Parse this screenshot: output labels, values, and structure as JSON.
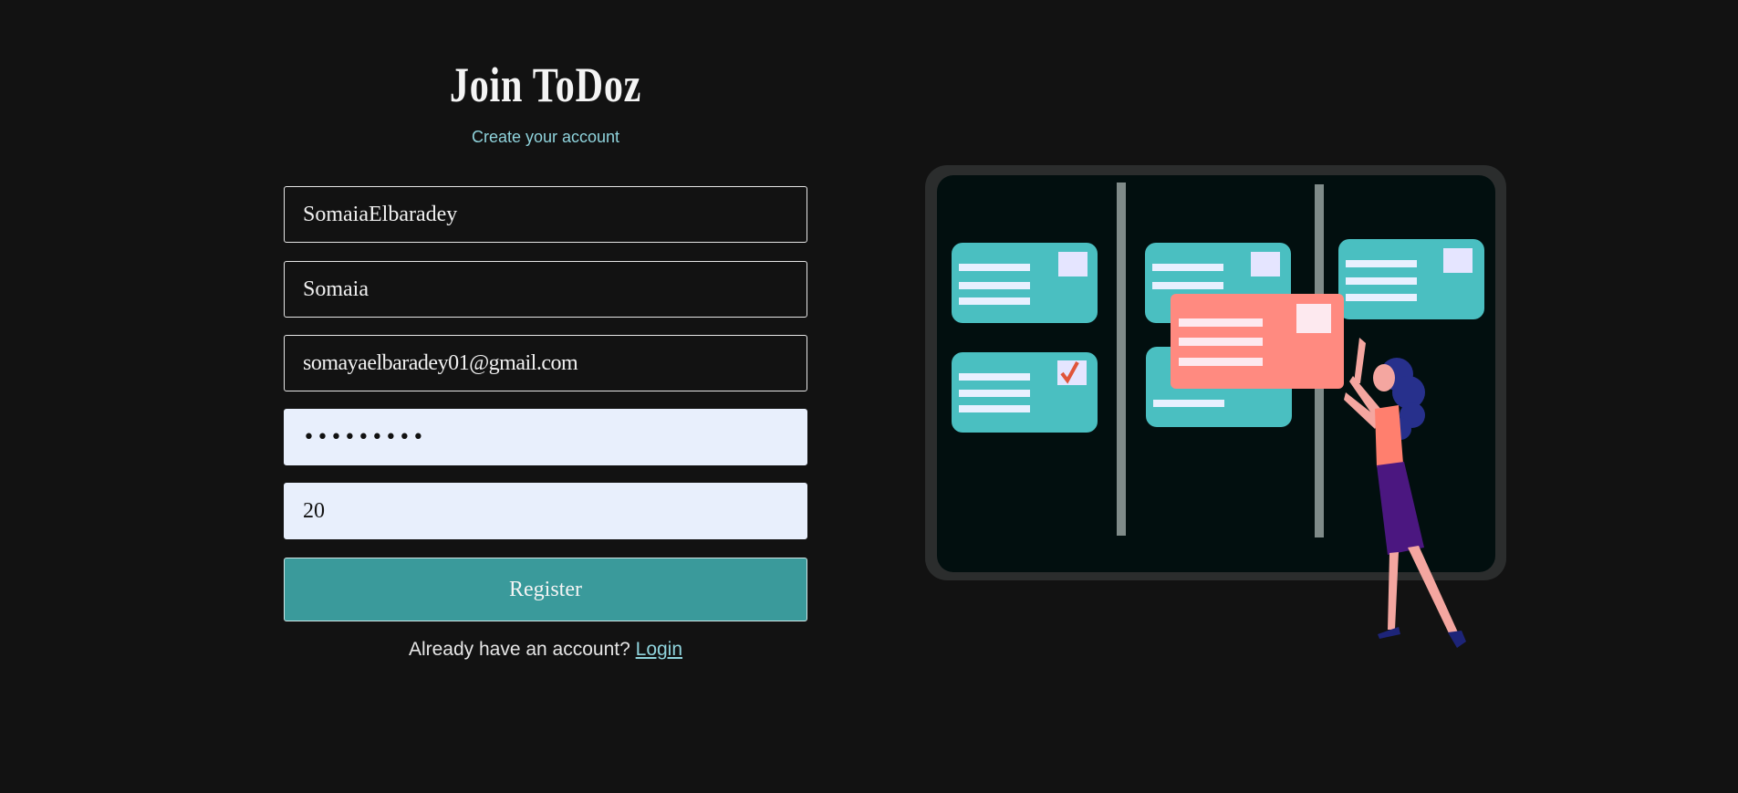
{
  "header": {
    "title": "Join ToDoz",
    "subtitle": "Create your account"
  },
  "form": {
    "username_value": "SomaiaElbaradey",
    "name_value": "Somaia",
    "email_value": "somayaelbaradey01@gmail.com",
    "password_value": "•••••••••",
    "age_value": "20",
    "register_label": "Register"
  },
  "footer": {
    "prompt_text": "Already have an account?",
    "login_label": "Login"
  },
  "colors": {
    "background": "#121212",
    "accent_teal": "#3a9a9b",
    "link": "#8fd3dc",
    "card_teal": "#4abfc1",
    "card_coral": "#ff8a80"
  },
  "illustration": {
    "icon": "kanban-board-woman-illustration"
  }
}
